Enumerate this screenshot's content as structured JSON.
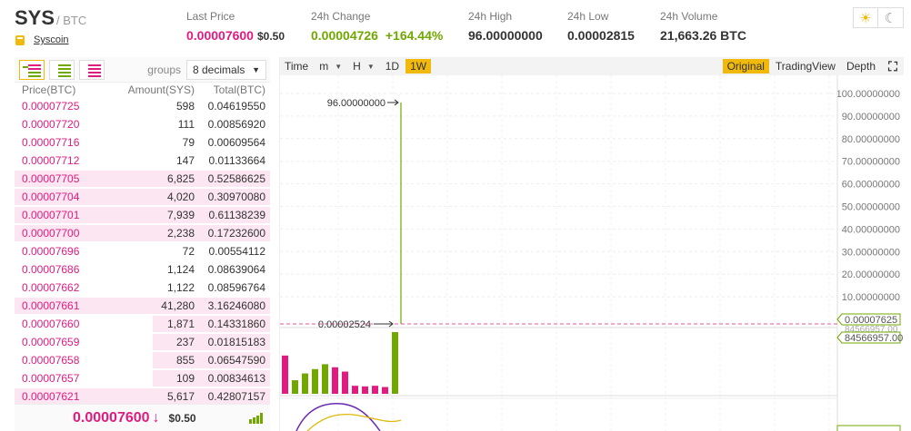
{
  "header": {
    "pair": "SYS",
    "quote": "/ BTC",
    "coin_name": "Syscoin",
    "last_price_label": "Last Price",
    "last_price": "0.00007600",
    "last_price_usd": "$0.50",
    "change_label": "24h Change",
    "change_value": "0.00004726",
    "change_pct": "+164.44%",
    "high_label": "24h High",
    "high_value": "96.00000000",
    "low_label": "24h Low",
    "low_value": "0.00002815",
    "volume_label": "24h Volume",
    "volume_value": "21,663.26 BTC",
    "theme_light_icon": "sun-icon",
    "theme_dark_icon": "moon-icon"
  },
  "orderbook": {
    "groups_label": "groups",
    "groups_value": "8 decimals",
    "columns": [
      "Price(BTC)",
      "Amount(SYS)",
      "Total(BTC)"
    ],
    "rows": [
      {
        "price": "0.00007725",
        "amount": "598",
        "total": "0.04619550",
        "depth": 0.0
      },
      {
        "price": "0.00007720",
        "amount": "111",
        "total": "0.00856920",
        "depth": 0.0
      },
      {
        "price": "0.00007716",
        "amount": "79",
        "total": "0.00609564",
        "depth": 0.0
      },
      {
        "price": "0.00007712",
        "amount": "147",
        "total": "0.01133664",
        "depth": 0.0
      },
      {
        "price": "0.00007705",
        "amount": "6,825",
        "total": "0.52586625",
        "depth": 1.0
      },
      {
        "price": "0.00007704",
        "amount": "4,020",
        "total": "0.30970080",
        "depth": 1.0
      },
      {
        "price": "0.00007701",
        "amount": "7,939",
        "total": "0.61138239",
        "depth": 1.0
      },
      {
        "price": "0.00007700",
        "amount": "2,238",
        "total": "0.17232600",
        "depth": 1.0
      },
      {
        "price": "0.00007696",
        "amount": "72",
        "total": "0.00554112",
        "depth": 0.0
      },
      {
        "price": "0.00007686",
        "amount": "1,124",
        "total": "0.08639064",
        "depth": 0.0
      },
      {
        "price": "0.00007662",
        "amount": "1,122",
        "total": "0.08596764",
        "depth": 0.0
      },
      {
        "price": "0.00007661",
        "amount": "41,280",
        "total": "3.16246080",
        "depth": 1.0
      },
      {
        "price": "0.00007660",
        "amount": "1,871",
        "total": "0.14331860",
        "depth": 0.46
      },
      {
        "price": "0.00007659",
        "amount": "237",
        "total": "0.01815183",
        "depth": 0.46
      },
      {
        "price": "0.00007658",
        "amount": "855",
        "total": "0.06547590",
        "depth": 0.46
      },
      {
        "price": "0.00007657",
        "amount": "109",
        "total": "0.00834613",
        "depth": 0.46
      },
      {
        "price": "0.00007621",
        "amount": "5,617",
        "total": "0.42807157",
        "depth": 1.0
      }
    ],
    "last_price": "0.00007600",
    "last_arrow": "↓",
    "last_usd": "$0.50"
  },
  "chart": {
    "toolbar": {
      "time": "Time",
      "m": "m",
      "h": "H",
      "d1": "1D",
      "w1": "1W",
      "original": "Original",
      "tradingview": "TradingView",
      "depth": "Depth"
    },
    "high_annotation": "96.00000000",
    "low_annotation": "0.00002524",
    "last_price_tag": "0.00007625",
    "volume_tag": "84566957.00",
    "volume_tag_hidden": "84566957.00"
  },
  "chart_data": {
    "type": "candlestick",
    "y_ticks": [
      "100.00000000",
      "90.00000000",
      "80.00000000",
      "70.00000000",
      "60.00000000",
      "50.00000000",
      "40.00000000",
      "30.00000000",
      "20.00000000",
      "10.00000000"
    ],
    "ylim": [
      0,
      100
    ],
    "high": 96.0,
    "low": 2.524e-05,
    "last": 7.625e-05,
    "volume_bars": [
      {
        "color": "#e11b80",
        "value": 0.62
      },
      {
        "color": "#70a800",
        "value": 0.22
      },
      {
        "color": "#70a800",
        "value": 0.33
      },
      {
        "color": "#70a800",
        "value": 0.4
      },
      {
        "color": "#70a800",
        "value": 0.48
      },
      {
        "color": "#e11b80",
        "value": 0.43
      },
      {
        "color": "#e11b80",
        "value": 0.36
      },
      {
        "color": "#e11b80",
        "value": 0.13
      },
      {
        "color": "#e11b80",
        "value": 0.12
      },
      {
        "color": "#e11b80",
        "value": 0.13
      },
      {
        "color": "#e11b80",
        "value": 0.11
      },
      {
        "color": "#70a800",
        "value": 1.0
      }
    ]
  }
}
